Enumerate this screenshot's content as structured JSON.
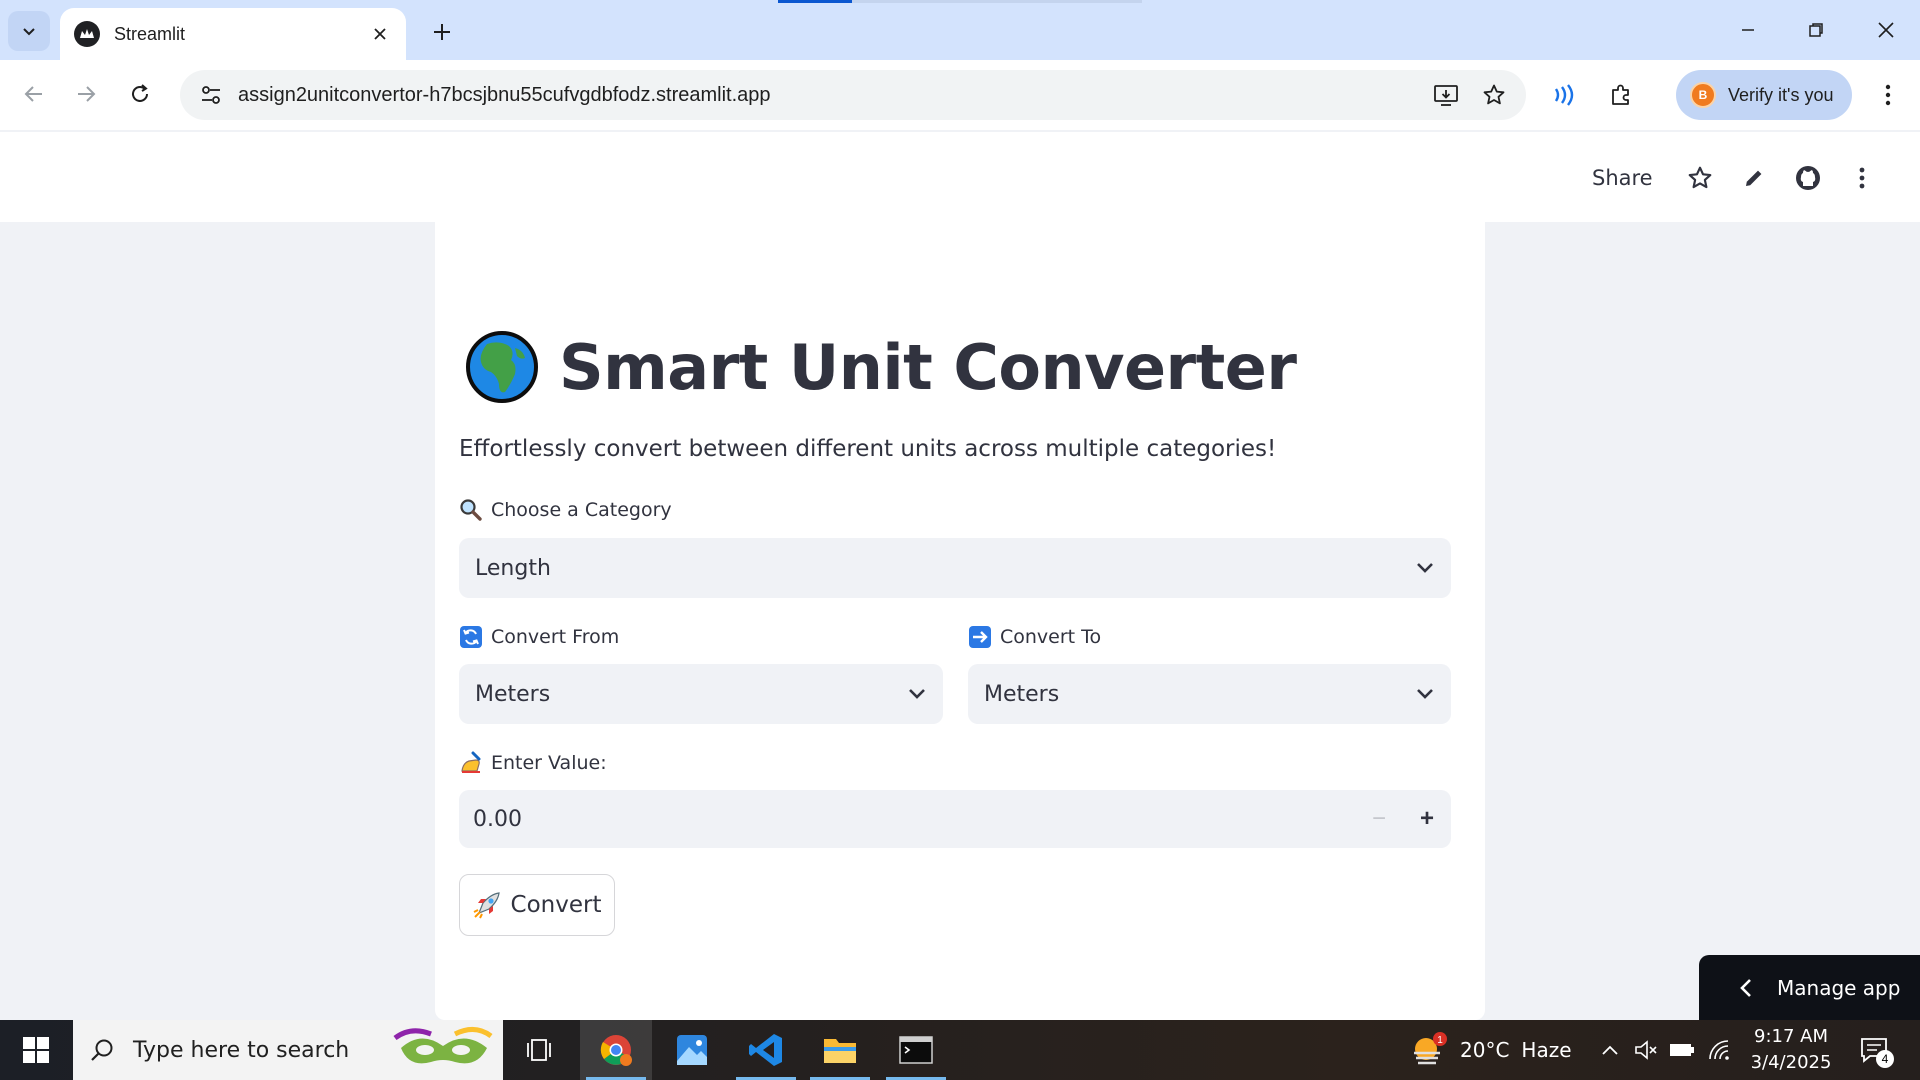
{
  "browser": {
    "tab_title": "Streamlit",
    "url": "assign2unitconvertor-h7bcsjbnu55cufvgdbfodz.streamlit.app",
    "profile_avatar_letter": "B",
    "profile_label": "Verify it's you"
  },
  "header": {
    "share_label": "Share"
  },
  "app": {
    "title": "Smart Unit Converter",
    "subtitle": "Effortlessly convert between different units across multiple categories!",
    "category": {
      "label": "Choose a Category",
      "value": "Length"
    },
    "convert_from": {
      "label": "Convert From",
      "value": "Meters"
    },
    "convert_to": {
      "label": "Convert To",
      "value": "Meters"
    },
    "value_input": {
      "label": "Enter Value:",
      "value": "0.00",
      "minus": "−",
      "plus": "+"
    },
    "convert_button": {
      "label": "Convert"
    },
    "manage_app_label": "Manage app"
  },
  "taskbar": {
    "search_placeholder": "Type here to search",
    "weather_temp": "20°C",
    "weather_desc": "Haze",
    "weather_badge": "1",
    "time": "9:17 AM",
    "date": "3/4/2025",
    "notification_count": "4"
  },
  "colors": {
    "accent": "#0b57d0",
    "tabbar_bg": "#d3e3fd",
    "streamlit_bg": "#f0f2f6",
    "text": "#31333f",
    "manage_app_bg": "#0e1117"
  },
  "icons": [
    "tab-search-icon",
    "streamlit-icon",
    "close-icon",
    "plus-icon",
    "minimize-icon",
    "restore-icon",
    "back-icon",
    "forward-icon",
    "reload-icon",
    "tune-icon",
    "install-icon",
    "star-icon",
    "extension-icon",
    "puzzle-icon",
    "kebab-icon",
    "pencil-icon",
    "github-icon",
    "globe-icon",
    "magnifier-icon",
    "refresh-arrows-icon",
    "right-arrow-icon",
    "writing-hand-icon",
    "rocket-icon",
    "chevron-down-icon",
    "chevron-left-icon",
    "windows-icon",
    "search-icon",
    "task-view-icon",
    "chrome-icon",
    "photos-icon",
    "vscode-icon",
    "folder-icon",
    "terminal-icon",
    "weather-icon",
    "chevron-up-icon",
    "volume-icon",
    "battery-icon",
    "wifi-icon",
    "notification-icon"
  ]
}
